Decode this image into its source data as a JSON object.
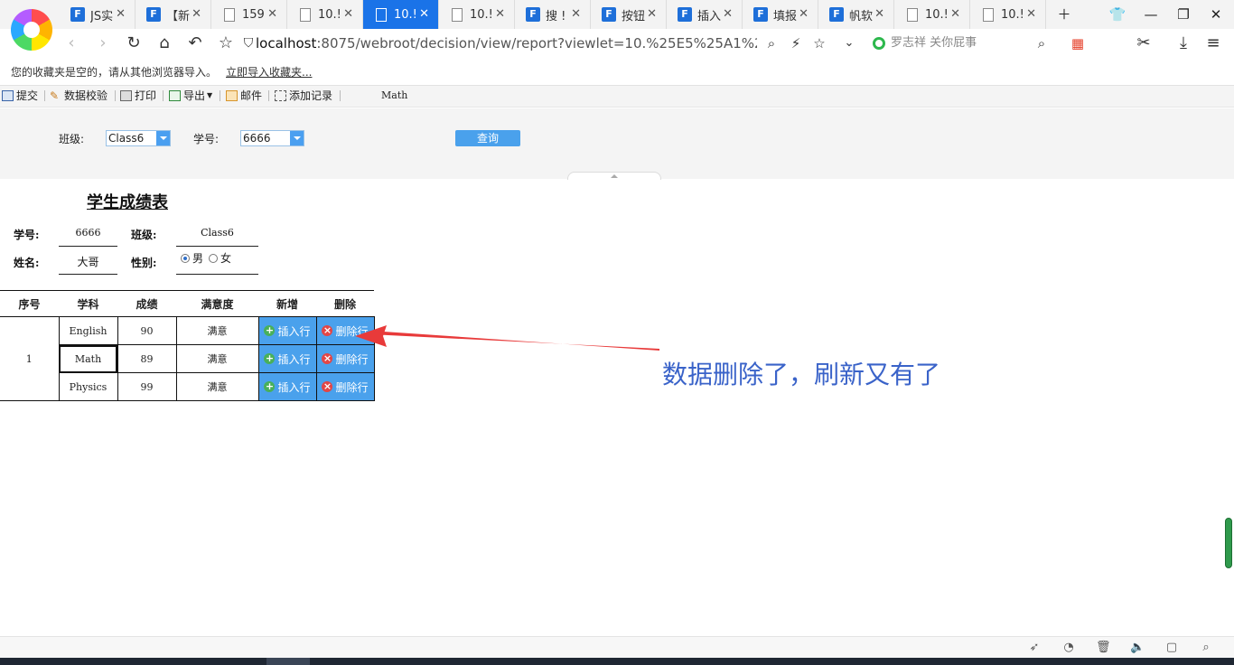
{
  "browser": {
    "tabs": [
      {
        "label": "JS实",
        "icon": "fr"
      },
      {
        "label": "【新",
        "icon": "fr"
      },
      {
        "label": "159",
        "icon": "doc"
      },
      {
        "label": "10.!",
        "icon": "doc"
      },
      {
        "label": "10.!",
        "icon": "doc",
        "active": true
      },
      {
        "label": "10.!",
        "icon": "doc"
      },
      {
        "label": "搜 !",
        "icon": "fr"
      },
      {
        "label": "按钮",
        "icon": "fr"
      },
      {
        "label": "插入",
        "icon": "fr"
      },
      {
        "label": "填报",
        "icon": "fr"
      },
      {
        "label": "帆软",
        "icon": "fr"
      },
      {
        "label": "10.!",
        "icon": "doc"
      },
      {
        "label": "10.!",
        "icon": "doc"
      }
    ],
    "url_host": "localhost",
    "url_rest": ":8075/webroot/decision/view/report?viewlet=10.%25E5%25A1%25AB9",
    "search_text": "罗志祥 关你屁事",
    "bookmark_notice": "您的收藏夹是空的，请从其他浏览器导入。",
    "bookmark_link": "立即导入收藏夹..."
  },
  "toolbar": {
    "submit": "提交",
    "validate": "数据校验",
    "print": "打印",
    "export": "导出",
    "mail": "邮件",
    "add_record": "添加记录",
    "extra": "Math"
  },
  "params": {
    "class_label": "班级:",
    "class_value": "Class6",
    "id_label": "学号:",
    "id_value": "6666",
    "query": "查询"
  },
  "report": {
    "title": "学生成绩表",
    "id_label": "学号:",
    "id_value": "6666",
    "class_label": "班级:",
    "class_value": "Class6",
    "name_label": "姓名:",
    "name_value": "大哥",
    "gender_label": "性别:",
    "gender_male": "男",
    "gender_female": "女",
    "gender_selected": "男",
    "headers": [
      "序号",
      "学科",
      "成绩",
      "满意度",
      "新增",
      "删除"
    ],
    "seq": "1",
    "rows": [
      {
        "subject": "English",
        "score": "90",
        "satisfaction": "满意"
      },
      {
        "subject": "Math",
        "score": "89",
        "satisfaction": "满意"
      },
      {
        "subject": "Physics",
        "score": "99",
        "satisfaction": "满意"
      }
    ],
    "insert_label": "插入行",
    "delete_label": "删除行"
  },
  "annotation": {
    "text": "数据删除了，刷新又有了",
    "color": "#3a63c9",
    "arrow_color": "#e83a3a"
  }
}
